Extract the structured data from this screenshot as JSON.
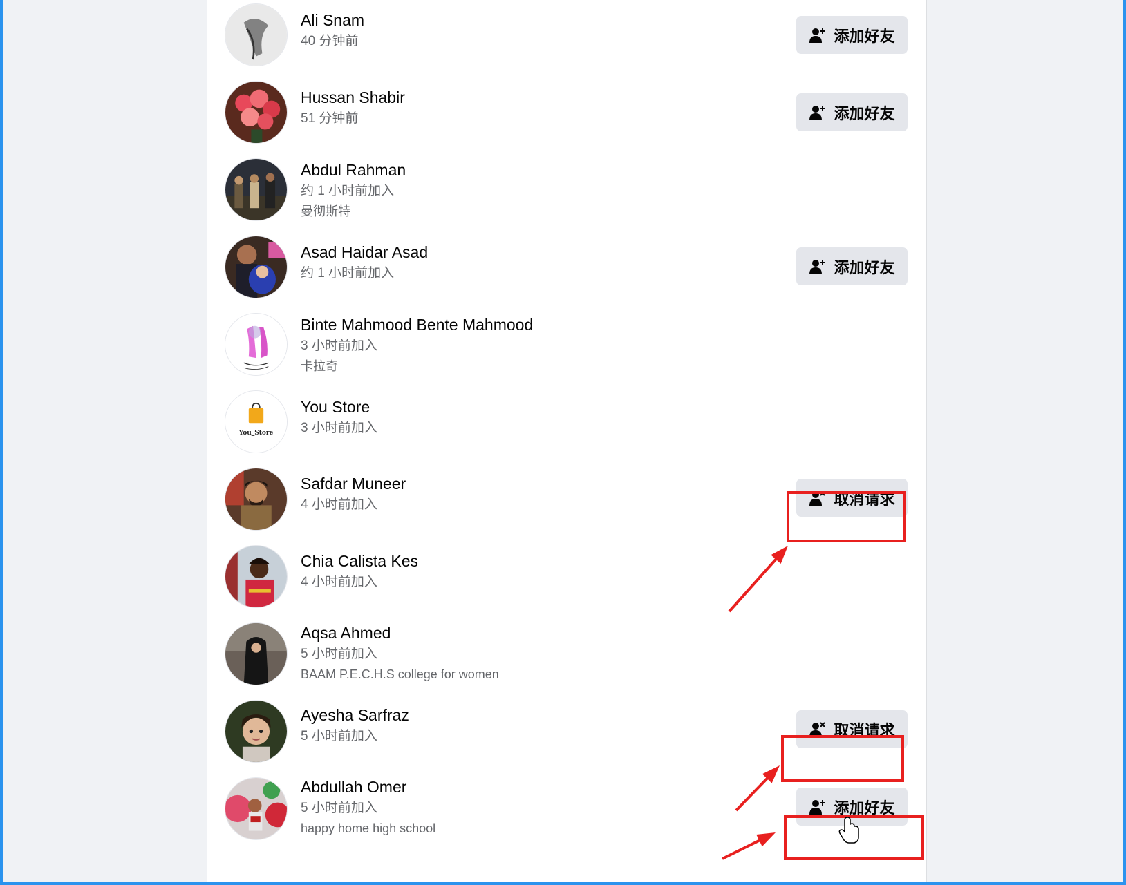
{
  "people": [
    {
      "name": "Ali Snam",
      "meta": "40 分钟前",
      "detail": "",
      "button": "添加好友",
      "button_kind": "add",
      "avatar": "sketch-figure"
    },
    {
      "name": "Hussan Shabir",
      "meta": "51 分钟前",
      "detail": "",
      "button": "添加好友",
      "button_kind": "add",
      "avatar": "rose-bouquet"
    },
    {
      "name": "Abdul Rahman",
      "meta": "约 1 小时前加入",
      "detail": "曼彻斯特",
      "button": "",
      "button_kind": "none",
      "avatar": "group-photo"
    },
    {
      "name": "Asad Haidar Asad",
      "meta": "约 1 小时前加入",
      "detail": "",
      "button": "添加好友",
      "button_kind": "add",
      "avatar": "child-with-baby"
    },
    {
      "name": "Binte Mahmood Bente Mahmood",
      "meta": "3 小时前加入",
      "detail": "卡拉奇",
      "button": "",
      "button_kind": "none",
      "avatar": "praying-hands"
    },
    {
      "name": "You Store",
      "meta": "3 小时前加入",
      "detail": "",
      "button": "",
      "button_kind": "none",
      "avatar": "shopping-bag-logo",
      "logo_text": "You_Store"
    },
    {
      "name": "Safdar Muneer",
      "meta": "4 小时前加入",
      "detail": "",
      "button": "取消请求",
      "button_kind": "cancel",
      "avatar": "man-portrait"
    },
    {
      "name": "Chia Calista Kes",
      "meta": "4 小时前加入",
      "detail": "",
      "button": "",
      "button_kind": "none",
      "avatar": "woman-red-dress"
    },
    {
      "name": "Aqsa Ahmed",
      "meta": "5 小时前加入",
      "detail": "BAAM P.E.C.H.S college for women",
      "button": "",
      "button_kind": "none",
      "avatar": "woman-black"
    },
    {
      "name": "Ayesha Sarfraz",
      "meta": "5 小时前加入",
      "detail": "",
      "button": "取消请求",
      "button_kind": "cancel",
      "avatar": "girl-portrait"
    },
    {
      "name": "Abdullah Omer",
      "meta": "5 小时前加入",
      "detail": "happy home high school",
      "button": "添加好友",
      "button_kind": "add",
      "avatar": "child-balloons"
    }
  ],
  "icons": {
    "add": "person-add-icon",
    "cancel": "person-remove-icon"
  },
  "colors": {
    "annotation": "#e8201f",
    "button_bg": "#e4e6eb",
    "frame": "#2b93ee"
  }
}
